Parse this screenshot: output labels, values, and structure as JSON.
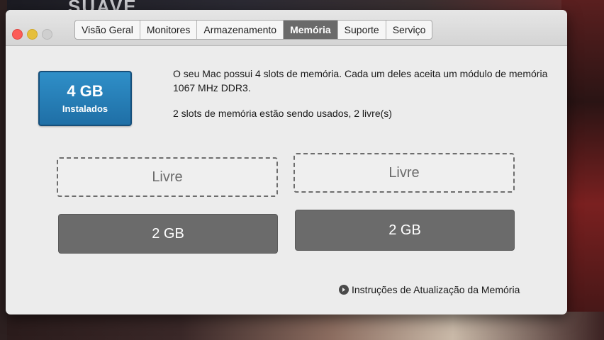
{
  "background": {
    "text": "SUAVE"
  },
  "tabs": [
    {
      "label": "Visão Geral",
      "active": false
    },
    {
      "label": "Monitores",
      "active": false
    },
    {
      "label": "Armazenamento",
      "active": false
    },
    {
      "label": "Memória",
      "active": true
    },
    {
      "label": "Suporte",
      "active": false
    },
    {
      "label": "Serviço",
      "active": false
    }
  ],
  "memory": {
    "total": "4 GB",
    "installed_label": "Instalados",
    "description_line1": "O seu Mac possui 4 slots de memória. Cada um deles aceita um módulo de memória 1067 MHz DDR3.",
    "description_line2": "2 slots de memória estão sendo usados, 2 livre(s)",
    "slots": [
      {
        "label": "Livre",
        "state": "free"
      },
      {
        "label": "Livre",
        "state": "free"
      },
      {
        "label": "2 GB",
        "state": "used"
      },
      {
        "label": "2 GB",
        "state": "used"
      }
    ],
    "upgrade_link": "Instruções de Atualização da Memória"
  },
  "colors": {
    "badge": "#1f6fa6",
    "active_tab": "#6a6a6a",
    "used_slot": "#6b6b6b",
    "close": "#fc5b57",
    "minimize": "#e5bf3c",
    "zoom": "#cfcfcf"
  },
  "icons": {
    "upgrade": "arrow-circle-icon"
  }
}
